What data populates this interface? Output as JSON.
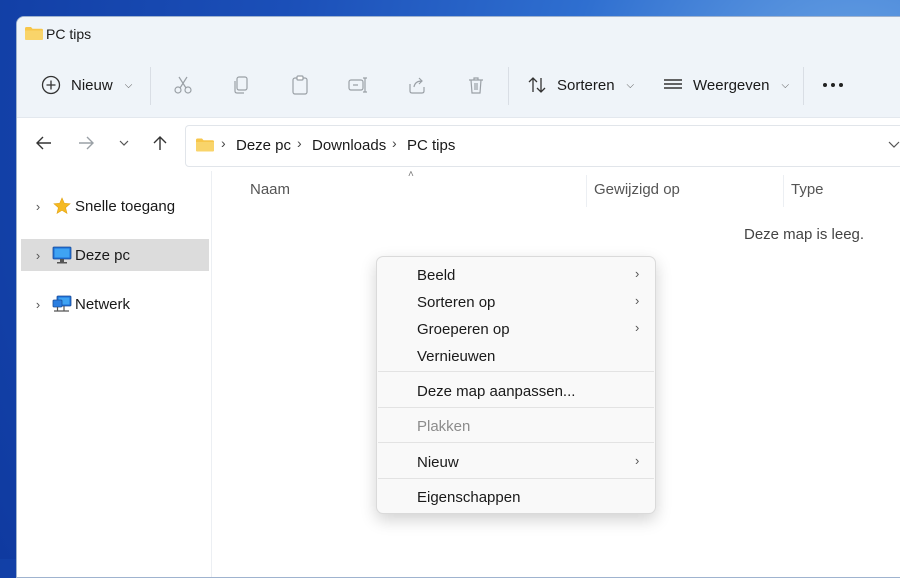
{
  "window": {
    "title": "PC tips"
  },
  "toolbar": {
    "new_label": "Nieuw",
    "sort_label": "Sorteren",
    "view_label": "Weergeven"
  },
  "address": {
    "crumbs": [
      "Deze pc",
      "Downloads",
      "PC tips"
    ]
  },
  "sidebar": {
    "items": [
      {
        "label": "Snelle toegang",
        "icon": "star-icon"
      },
      {
        "label": "Deze pc",
        "icon": "monitor-icon",
        "selected": true
      },
      {
        "label": "Netwerk",
        "icon": "network-icon"
      }
    ]
  },
  "content": {
    "columns": [
      "Naam",
      "Gewijzigd op",
      "Type"
    ],
    "empty_text": "Deze map is leeg."
  },
  "context_menu": {
    "items": [
      {
        "label": "Beeld",
        "submenu": true
      },
      {
        "label": "Sorteren op",
        "submenu": true
      },
      {
        "label": "Groeperen op",
        "submenu": true
      },
      {
        "label": "Vernieuwen"
      },
      {
        "label": "Deze map aanpassen..."
      },
      {
        "label": "Plakken",
        "disabled": true
      },
      {
        "label": "Nieuw",
        "submenu": true
      },
      {
        "label": "Eigenschappen"
      }
    ]
  },
  "colors": {
    "accent": "#0067c0",
    "folder": "#f7c64a",
    "titlebar": "#eff4f9",
    "selected": "#dcdcdc"
  }
}
